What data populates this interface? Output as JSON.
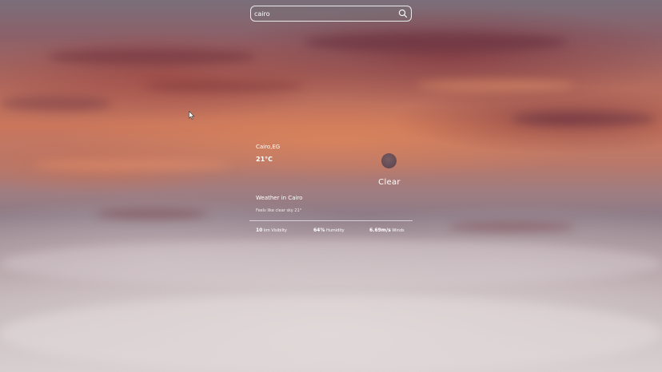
{
  "search": {
    "value": "cairo",
    "icon": "search-icon"
  },
  "weather": {
    "city": "Cairo,EG",
    "temperature": "21°C",
    "condition": "Clear",
    "heading": "Weather in Cairo",
    "feels_like": "Feels like clear sky 21°",
    "icon": "weather-condition-icon",
    "stats": {
      "visibility_value": "10",
      "visibility_label": "km Visibilty",
      "humidity_value": "64%",
      "humidity_label": "Humidity",
      "wind_value": "6.69m/s",
      "wind_label": "Winds"
    }
  },
  "colors": {
    "text": "#ffffff",
    "search_border": "#ffffff",
    "icon": "#5a4550"
  }
}
